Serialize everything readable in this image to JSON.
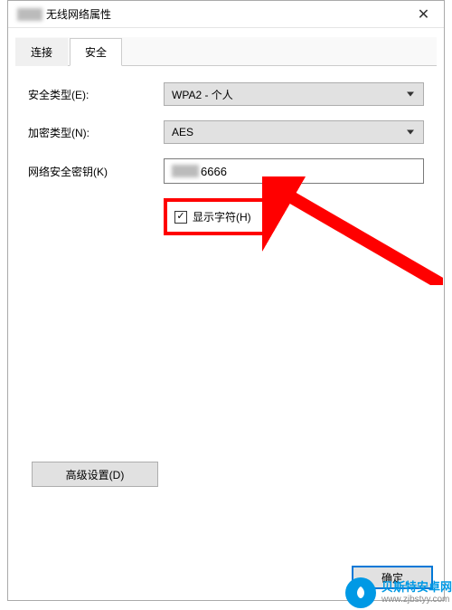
{
  "window": {
    "title": "无线网络属性"
  },
  "tabs": {
    "connect": "连接",
    "security": "安全"
  },
  "labels": {
    "security_type": "安全类型(E):",
    "encryption_type": "加密类型(N):",
    "network_key": "网络安全密钥(K)"
  },
  "values": {
    "security_type": "WPA2 - 个人",
    "encryption_type": "AES",
    "network_key_visible": "6666"
  },
  "checkbox": {
    "show_chars": "显示字符(H)",
    "checked": "✓"
  },
  "buttons": {
    "advanced": "高级设置(D)",
    "ok": "确定",
    "close": "✕"
  },
  "watermark": {
    "name": "贝斯特安卓网",
    "url": "www.zjbstyy.com"
  }
}
